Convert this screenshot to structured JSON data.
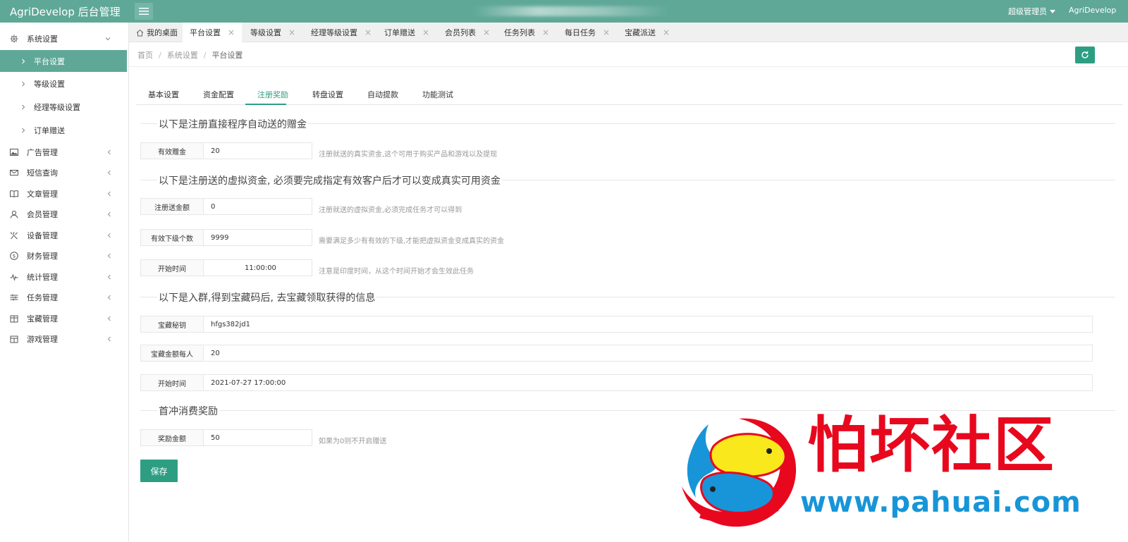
{
  "app": {
    "title": "AgriDevelop 后台管理",
    "user": "超级管理员",
    "site": "AgriDevelop"
  },
  "sidebar": {
    "group": {
      "label": "系统设置",
      "icon": "gear-icon"
    },
    "sub_items": [
      {
        "label": "平台设置",
        "active": true
      },
      {
        "label": "等级设置",
        "active": false
      },
      {
        "label": "经理等级设置",
        "active": false
      },
      {
        "label": "订单赠送",
        "active": false
      }
    ],
    "items": [
      {
        "label": "广告管理",
        "icon": "image-icon"
      },
      {
        "label": "短信查询",
        "icon": "mail-icon"
      },
      {
        "label": "文章管理",
        "icon": "book-icon"
      },
      {
        "label": "会员管理",
        "icon": "user-icon"
      },
      {
        "label": "设备管理",
        "icon": "device-icon"
      },
      {
        "label": "财务管理",
        "icon": "money-icon"
      },
      {
        "label": "统计管理",
        "icon": "chart-icon"
      },
      {
        "label": "任务管理",
        "icon": "task-icon"
      },
      {
        "label": "宝藏管理",
        "icon": "treasure-icon"
      },
      {
        "label": "游戏管理",
        "icon": "game-icon"
      }
    ]
  },
  "tabs": [
    {
      "label": "我的桌面",
      "closable": false,
      "active": false
    },
    {
      "label": "平台设置",
      "closable": true,
      "active": true
    },
    {
      "label": "等级设置",
      "closable": true,
      "active": false
    },
    {
      "label": "经理等级设置",
      "closable": true,
      "active": false
    },
    {
      "label": "订单赠送",
      "closable": true,
      "active": false
    },
    {
      "label": "会员列表",
      "closable": true,
      "active": false
    },
    {
      "label": "任务列表",
      "closable": true,
      "active": false
    },
    {
      "label": "每日任务",
      "closable": true,
      "active": false
    },
    {
      "label": "宝藏派送",
      "closable": true,
      "active": false
    }
  ],
  "breadcrumb": {
    "home": "首页",
    "parent": "系统设置",
    "current": "平台设置",
    "separator": "/"
  },
  "subtabs": [
    "基本设置",
    "资金配置",
    "注册奖励",
    "转盘设置",
    "自动提款",
    "功能测试"
  ],
  "active_subtab": "注册奖励",
  "sections": {
    "s1": "以下是注册直接程序自动送的赠金",
    "s2": "以下是注册送的虚拟资金, 必须要完成指定有效客户后才可以变成真实可用资金",
    "s3": "以下是入群,得到宝藏码后, 去宝藏领取获得的信息",
    "s4": "首冲消费奖励"
  },
  "fields": {
    "bonus": {
      "label": "有效赠金",
      "value": "20",
      "hint": "注册就送的真实资金,这个可用于购买产品和游戏以及提现"
    },
    "virtual": {
      "label": "注册送金额",
      "value": "0",
      "hint": "注册就送的虚拟资金,必须完成任务才可以得到"
    },
    "sub_count": {
      "label": "有效下级个数",
      "value": "9999",
      "hint": "需要满足多少有有效的下级,才能把虚拟资金变成真实的资金"
    },
    "start_time": {
      "label": "开始时间",
      "value": "11:00:00",
      "hint": "注意是印度时间，从这个时间开始才会生效此任务"
    },
    "treasure_key": {
      "label": "宝藏秘钥",
      "value": "hfgs382jd1"
    },
    "treasure_amount": {
      "label": "宝藏金额每人",
      "value": "20"
    },
    "treasure_time": {
      "label": "开始时间",
      "value": "2021-07-27 17:00:00"
    },
    "first_reward": {
      "label": "奖励金额",
      "value": "50",
      "hint": "如果为0则不开启赠送"
    }
  },
  "save_label": "保存",
  "watermark": {
    "text": "怕坏社区",
    "url": "www.pahuai.com"
  },
  "colors": {
    "topbar": "#5fa898",
    "accent": "#2e9e83",
    "watermark_red": "#e8081e",
    "watermark_blue": "#1795d8"
  }
}
